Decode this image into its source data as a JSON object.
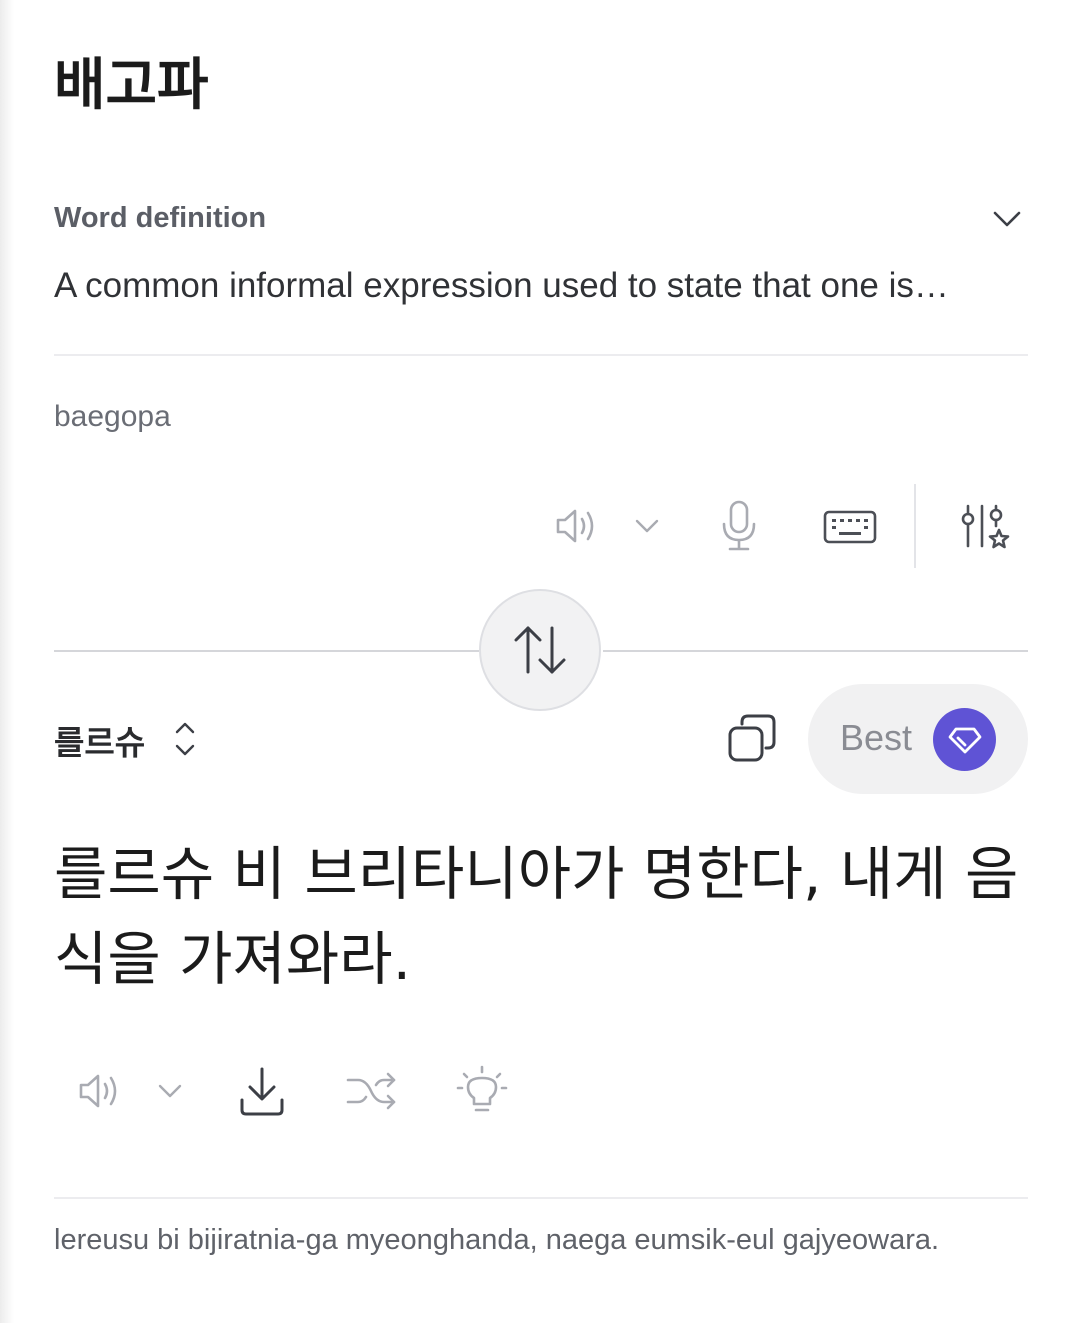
{
  "source": {
    "word": "배고파",
    "definition_label": "Word definition",
    "definition_text": "A common informal expression used to state that one is…",
    "romanization": "baegopa"
  },
  "input_toolbar": {
    "icons": [
      "speaker-icon",
      "chevron-down-icon",
      "microphone-icon",
      "keyboard-icon",
      "settings-star-icon"
    ]
  },
  "target": {
    "language": "를르슈",
    "best_label": "Best",
    "translation": "를르슈 비 브리타니아가 명한다, 내게 음식을 가져와라.",
    "transliteration": "lereusu bi bijiratnia-ga myeonghanda, naega eumsik-eul gajyeowara."
  },
  "output_toolbar": {
    "icons": [
      "speaker-icon",
      "chevron-down-icon",
      "download-icon",
      "shuffle-icon",
      "lightbulb-icon"
    ]
  },
  "colors": {
    "accent": "#5f53d5",
    "icon_dark": "#3c3f46",
    "icon_light": "#a9abb2"
  }
}
